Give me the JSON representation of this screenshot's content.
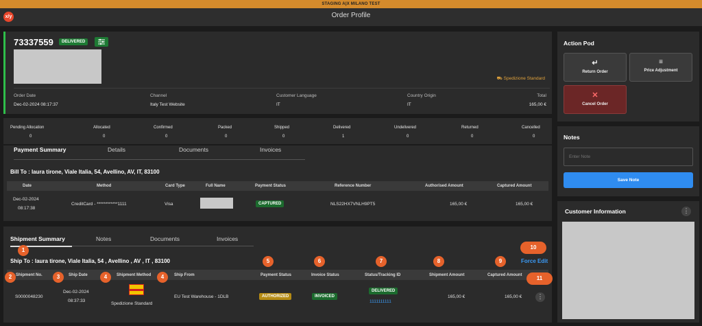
{
  "topbar": {
    "env_label": "STAGING A|X MILANO TEST"
  },
  "titlebar": {
    "title": "Order Profile",
    "xy_badge": "x/y"
  },
  "order": {
    "number": "73337559",
    "status": "DELIVERED",
    "shipping_method": "Spedizione Standard",
    "fields": [
      {
        "label": "Order Date",
        "value": "Dec-02-2024 08:17:37"
      },
      {
        "label": "Channel",
        "value": "Italy Test Website"
      },
      {
        "label": "Customer Language",
        "value": "IT"
      },
      {
        "label": "Country Origin",
        "value": "IT"
      },
      {
        "label": "Total",
        "value": "165,00 €"
      }
    ]
  },
  "status_counts": [
    {
      "label": "Pending Allocation",
      "value": "0"
    },
    {
      "label": "Allocated",
      "value": "0"
    },
    {
      "label": "Confirmed",
      "value": "0"
    },
    {
      "label": "Packed",
      "value": "0"
    },
    {
      "label": "Shipped",
      "value": "0"
    },
    {
      "label": "Delivered",
      "value": "1"
    },
    {
      "label": "Undelivered",
      "value": "0"
    },
    {
      "label": "Returned",
      "value": "0"
    },
    {
      "label": "Cancelled",
      "value": "0"
    }
  ],
  "payment_tabs": [
    "Payment Summary",
    "Details",
    "Documents",
    "Invoices"
  ],
  "bill_to": "Bill To : laura tirone, Viale Italia, 54, Avellino, AV, IT, 83100",
  "payment_table": {
    "headers": [
      "Date",
      "Method",
      "Card Type",
      "Full Name",
      "Payment Status",
      "Reference Number",
      "Authorised Amount",
      "Captured Amount"
    ],
    "row": {
      "date": "Dec-02-2024",
      "time": "08:17:38",
      "method": "CreditCard - ************1111",
      "card_type": "Visa",
      "payment_status": "CAPTURED",
      "reference": "NLS22HX7VNLH9PT5",
      "authorised": "165,00 €",
      "captured": "165,00 €"
    }
  },
  "shipment_tabs": [
    "Shipment Summary",
    "Notes",
    "Documents",
    "Invoices"
  ],
  "ship_to": "Ship To : laura tirone, Viale Italia, 54 , Avellino , AV , IT , 83100",
  "force_edit": "Force Edit",
  "shipment_table": {
    "headers": [
      "Shipment No.",
      "Ship Date",
      "Shipment Method",
      "Ship From",
      "Payment Status",
      "Invoice Status",
      "Status/Tracking ID",
      "Shipment Amount",
      "Captured Amount"
    ],
    "row": {
      "shipment_no": "S0000048230",
      "ship_date": "Dec-02-2024",
      "ship_time": "08:37:33",
      "method": "Spedizione Standard",
      "ship_from": "EU Test Warehouse - 1DLB",
      "payment_status": "AUTHORIZED",
      "invoice_status": "INVOICED",
      "status": "DELIVERED",
      "tracking_id": "1111111111",
      "shipment_amount": "165,00 €",
      "captured_amount": "165,00 €"
    }
  },
  "markers": [
    "1",
    "2",
    "3",
    "4",
    "4",
    "5",
    "6",
    "7",
    "8",
    "9",
    "10",
    "11"
  ],
  "action_pod": {
    "title": "Action Pod",
    "return_order": "Return Order",
    "price_adjustment": "Price Adjustment",
    "cancel_order": "Cancel Order"
  },
  "notes": {
    "title": "Notes",
    "placeholder": "Enter Note",
    "save": "Save Note"
  },
  "customer_info": {
    "title": "Customer Information"
  },
  "colors": {
    "accent_orange": "#e6622b",
    "status_green": "#1e7a34",
    "primary_blue": "#2f8cf0",
    "cancel_red": "#6b2626"
  }
}
